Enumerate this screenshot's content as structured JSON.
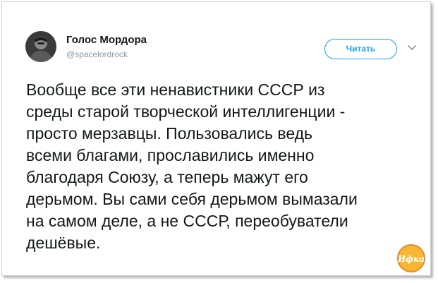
{
  "account": {
    "display_name": "Голос Мордора",
    "handle": "@spacelordrock",
    "avatar_icon": "avatar-photo"
  },
  "follow_button": {
    "label": "Читать"
  },
  "menu": {
    "icon": "chevron-down-icon"
  },
  "tweet": {
    "lines": [
      "Вообще все эти ненавистники СССР из",
      "среды старой творческой интеллигенции -",
      "просто мерзавцы. Пользовались ведь",
      "всеми благами, прославились именно",
      "благодаря Союзу, а теперь мажут его",
      "дерьмом. Вы сами себя дерьмом вымазали",
      "на самом деле, а не СССР, переобуватели",
      "дешёвые."
    ]
  },
  "watermark": {
    "text": "Ифка"
  },
  "colors": {
    "accent": "#1da1f2",
    "text": "#14171a",
    "secondary": "#8899a6",
    "watermark": "#f5a623"
  }
}
